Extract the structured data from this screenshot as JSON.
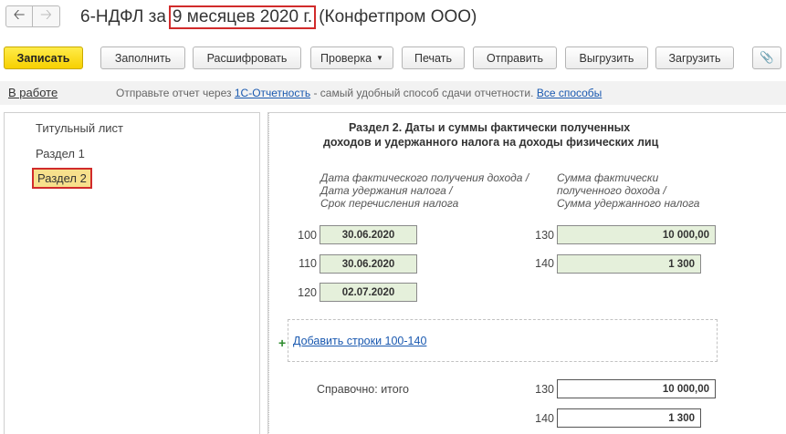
{
  "header": {
    "title_prefix": "6-НДФЛ за",
    "title_period": "9 месяцев 2020 г.",
    "title_org": "(Конфетпром ООО)",
    "back_glyph": "🡠",
    "forward_glyph": "🡢"
  },
  "toolbar": {
    "save": "Записать",
    "fill": "Заполнить",
    "decode": "Расшифровать",
    "check": "Проверка",
    "print": "Печать",
    "send": "Отправить",
    "export": "Выгрузить",
    "import": "Загрузить",
    "attach_glyph": "📎"
  },
  "infobar": {
    "status": "В работе",
    "text_before": "Отправьте отчет через",
    "link_service": "1С-Отчетность",
    "text_after": "- самый удобный способ сдачи отчетности.",
    "link_all": "Все способы"
  },
  "sidebar": {
    "items": [
      {
        "label": "Титульный лист"
      },
      {
        "label": "Раздел 1"
      },
      {
        "label": "Раздел 2"
      }
    ]
  },
  "section": {
    "title_line1": "Раздел 2.  Даты и суммы фактически полученных",
    "title_line2": "доходов и удержанного налога на доходы физических лиц",
    "left_hint": [
      "Дата фактического получения дохода /",
      "Дата удержания налога /",
      "Срок перечисления налога"
    ],
    "right_hint": [
      "Сумма фактически",
      "полученного дохода /",
      "Сумма удержанного налога"
    ],
    "rows": {
      "r100": {
        "code": "100",
        "value": "30.06.2020"
      },
      "r110": {
        "code": "110",
        "value": "30.06.2020"
      },
      "r120": {
        "code": "120",
        "value": "02.07.2020"
      },
      "r130": {
        "code": "130",
        "value": "10 000,00"
      },
      "r140": {
        "code": "140",
        "value": "1 300"
      }
    },
    "add_rows_link": "Добавить строки 100-140",
    "reference_label": "Справочно: итого",
    "totals": {
      "r130": {
        "code": "130",
        "value": "10 000,00"
      },
      "r140": {
        "code": "140",
        "value": "1 300"
      }
    }
  },
  "colors": {
    "accent_primary": "#f7d000",
    "highlight_border": "#d12b2b",
    "field_fill": "#e5f0db",
    "link": "#1a59b0"
  }
}
